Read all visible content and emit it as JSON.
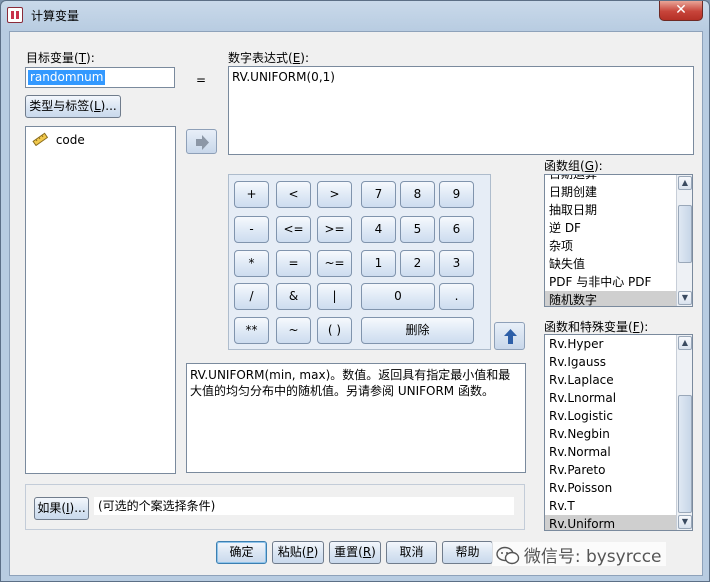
{
  "window": {
    "title": "计算变量",
    "close": "✕"
  },
  "target": {
    "label_text": "目标变量(",
    "label_key": "T",
    "label_end": "):",
    "value": "randomnum",
    "type_button_text": "类型与标签(",
    "type_button_key": "L",
    "type_button_end": ")..."
  },
  "equals": "=",
  "expression": {
    "label_text": "数字表达式(",
    "label_key": "E",
    "label_end": "):",
    "value": "RV.UNIFORM(0,1)"
  },
  "variables": [
    {
      "name": "code",
      "icon": "ruler-icon"
    }
  ],
  "keypad": {
    "row1": [
      "+",
      "<",
      ">",
      "7",
      "8",
      "9"
    ],
    "row2": [
      "-",
      "<=",
      ">=",
      "4",
      "5",
      "6"
    ],
    "row3": [
      "*",
      "=",
      "~=",
      "1",
      "2",
      "3"
    ],
    "row4": [
      "/",
      "&",
      "|",
      "0",
      "."
    ],
    "row5": [
      "**",
      "~",
      "( )",
      "删除"
    ]
  },
  "description": "RV.UNIFORM(min, max)。数值。返回具有指定最小值和最大值的均匀分布中的随机值。另请参阅 UNIFORM 函数。",
  "function_group": {
    "label_text": "函数组(",
    "label_key": "G",
    "label_end": "):",
    "items": [
      "日期创建",
      "抽取日期",
      "逆 DF",
      "杂项",
      "缺失值",
      "PDF 与非中心 PDF",
      "随机数字"
    ],
    "partial_item": "日期运算",
    "selected": "随机数字"
  },
  "functions": {
    "label_text": "函数和特殊变量(",
    "label_key": "F",
    "label_end": "):",
    "items": [
      "Rv.Hyper",
      "Rv.Igauss",
      "Rv.Laplace",
      "Rv.Lnormal",
      "Rv.Logistic",
      "Rv.Negbin",
      "Rv.Normal",
      "Rv.Pareto",
      "Rv.Poisson",
      "Rv.T",
      "Rv.Uniform"
    ],
    "selected": "Rv.Uniform"
  },
  "if_section": {
    "button_text": "如果(",
    "button_key": "I",
    "button_end": ")...",
    "condition": "(可选的个案选择条件)"
  },
  "bottom_buttons": {
    "ok": "确定",
    "paste_text": "粘贴(",
    "paste_key": "P",
    "paste_end": ")",
    "reset_text": "重置(",
    "reset_key": "R",
    "reset_end": ")",
    "cancel": "取消",
    "help": "帮助"
  },
  "watermark": "微信号: bysyrcce"
}
